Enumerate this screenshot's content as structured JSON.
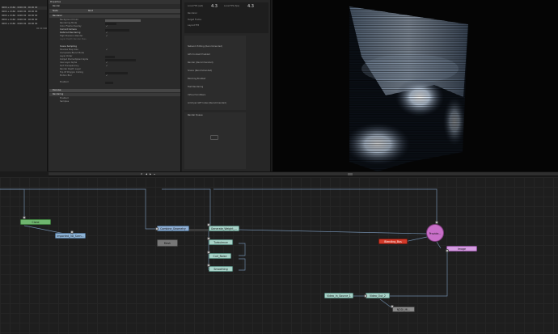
{
  "file_list": {
    "items": [
      "0000 + 0166 · 0000 00 · 00:00 00",
      "0000 + 0166 · 0000 00 · 00:00 00",
      "0000 + 0166 · 0000 00 · 00:00 00",
      "0000 + 0166 · 0000 00 · 00:00 00",
      "0000 + 0166 · 0000 00 · 00:00 00"
    ],
    "tag": "00 00 000"
  },
  "properties": {
    "title": "Properties",
    "tab": "Render",
    "header_name": "Node",
    "header_value": "Root",
    "sections": [
      "Renderer",
      "Denoise",
      "Rendering",
      "Sampling",
      "Advanced"
    ],
    "rows": [
      {
        "label": "Background Color",
        "value": ""
      },
      {
        "label": "Rendering Mode",
        "value": ""
      },
      {
        "label": "Color Frame Overlay",
        "value": ""
      },
      {
        "label": "Current Camera",
        "value": ""
      },
      {
        "label": "Deferred Rendering",
        "value": ""
      },
      {
        "label": "High Precision Render",
        "value": ""
      },
      {
        "label": "Layer Depth Render Pass",
        "value": ""
      },
      {
        "label": "Scene Sampling",
        "value": ""
      },
      {
        "label": "Shadow Map Size",
        "value": ""
      },
      {
        "label": "Composite Blend Mode",
        "value": ""
      },
      {
        "label": "Layer Order",
        "value": ""
      },
      {
        "label": "Output Premultiplied Alpha",
        "value": ""
      },
      {
        "label": "Use Layer Alpha",
        "value": ""
      },
      {
        "label": "Sort Transparency",
        "value": ""
      },
      {
        "label": "Render Depth Layer",
        "value": ""
      },
      {
        "label": "Top Of Polygon Culling",
        "value": ""
      },
      {
        "label": "Motion Blur",
        "value": ""
      }
    ],
    "sub_rows": [
      "Enabled",
      "Samples"
    ]
  },
  "stats": {
    "labels": [
      "Local FPS (est)",
      "Local FPS (fps)",
      "Renderer",
      "Target Frame",
      "Layout FPS"
    ],
    "values": [
      "4.3",
      "4.3"
    ],
    "buttons": [
      "Network Editing (Recommended)",
      "GPU Context Enabled",
      "Render (Recommended)",
      "Scene (Recommended)",
      "Blocking Enabled",
      "Fast Rendering",
      "Virtual Scrollbars",
      "Limit per GPT Index (Recommended)"
    ],
    "hud_title": "Render Queue"
  },
  "viewport": {
    "playback_controls": [
      "⏮",
      "◀",
      "▶",
      "⏭"
    ]
  },
  "nodes": [
    {
      "id": "clone",
      "label": "Clone",
      "color": "#6fb56f"
    },
    {
      "id": "imported",
      "label": "Imported_3D_Scen...",
      "color": "#8fb4d6"
    },
    {
      "id": "combine",
      "label": "Combine_Geometry",
      "color": "#8faed2"
    },
    {
      "id": "generate",
      "label": "Generate_Weight_...",
      "color": "#a8d2c8"
    },
    {
      "id": "turbulence",
      "label": "Turbulence",
      "color": "#a8d2c8"
    },
    {
      "id": "curl",
      "label": "Curl_Noise",
      "color": "#a8d2c8"
    },
    {
      "id": "smoothing",
      "label": "Smoothing",
      "color": "#a8d2c8"
    },
    {
      "id": "mesh",
      "label": "Mesh",
      "color": "#8a8a8a"
    },
    {
      "id": "provider",
      "label": "Provide...",
      "color": "#c86fc8"
    },
    {
      "id": "blending",
      "label": "Blending_Bus",
      "color": "#d23a2a"
    },
    {
      "id": "image",
      "label": "Image",
      "color": "#d49be0"
    },
    {
      "id": "video_source",
      "label": "Video_In_Source_1",
      "color": "#a8d2c8"
    },
    {
      "id": "video_out",
      "label": "Video_Out_2",
      "color": "#a8d2c8"
    },
    {
      "id": "output",
      "label": "NDDI_Mi...",
      "color": "#8a8a8a"
    }
  ]
}
